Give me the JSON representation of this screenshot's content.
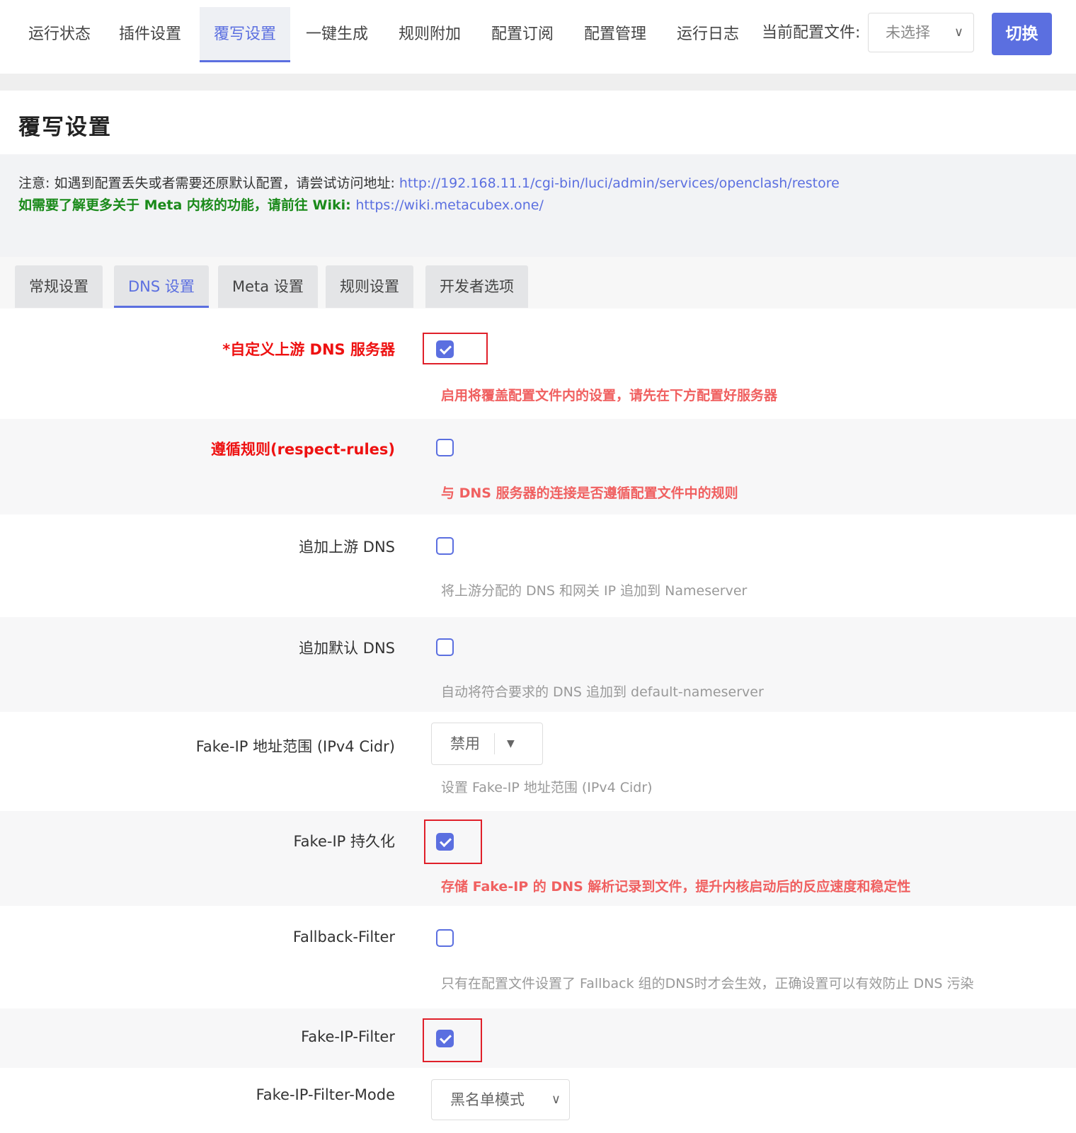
{
  "nav": {
    "items": [
      "运行状态",
      "插件设置",
      "覆写设置",
      "一键生成",
      "规则附加",
      "配置订阅",
      "配置管理",
      "运行日志"
    ],
    "profile_label": "当前配置文件:",
    "profile_value": "未选择",
    "switch_label": "切换"
  },
  "page": {
    "title": "覆写设置"
  },
  "notice": {
    "line1_text": "注意: 如遇到配置丢失或者需要还原默认配置，请尝试访问地址: ",
    "line1_link": "http://192.168.11.1/cgi-bin/luci/admin/services/openclash/restore",
    "line2_text": "如需要了解更多关于 Meta 内核的功能，请前往 Wiki: ",
    "line2_link": "https://wiki.metacubex.one/"
  },
  "subtabs": [
    "常规设置",
    "DNS 设置",
    "Meta 设置",
    "规则设置",
    "开发者选项"
  ],
  "form": {
    "custom_upstream": {
      "label": "*自定义上游 DNS 服务器",
      "checked": true,
      "desc": "启用将覆盖配置文件内的设置，请先在下方配置好服务器"
    },
    "respect_rules": {
      "label": "遵循规则(respect-rules)",
      "checked": false,
      "desc": "与 DNS 服务器的连接是否遵循配置文件中的规则"
    },
    "append_upstream": {
      "label": "追加上游 DNS",
      "checked": false,
      "desc": "将上游分配的 DNS 和网关 IP 追加到 Nameserver"
    },
    "append_default": {
      "label": "追加默认 DNS",
      "checked": false,
      "desc": "自动将符合要求的 DNS 追加到 default-nameserver"
    },
    "fakeip_range": {
      "label": "Fake-IP 地址范围 (IPv4 Cidr)",
      "value": "禁用",
      "desc": "设置 Fake-IP 地址范围 (IPv4 Cidr)"
    },
    "fakeip_persist": {
      "label": "Fake-IP 持久化",
      "checked": true,
      "desc": "存储 Fake-IP 的 DNS 解析记录到文件，提升内核启动后的反应速度和稳定性"
    },
    "fallback_filter": {
      "label": "Fallback-Filter",
      "checked": false,
      "desc": "只有在配置文件设置了 Fallback 组的DNS时才会生效，正确设置可以有效防止 DNS 污染"
    },
    "fakeip_filter": {
      "label": "Fake-IP-Filter",
      "checked": true
    },
    "fakeip_filter_mode": {
      "label": "Fake-IP-Filter-Mode",
      "value": "黑名单模式"
    }
  },
  "colors": {
    "accent": "#5b6fe0",
    "warning": "#ee1111",
    "success": "#1a8a1a",
    "highlight_box": "#e0202a"
  }
}
